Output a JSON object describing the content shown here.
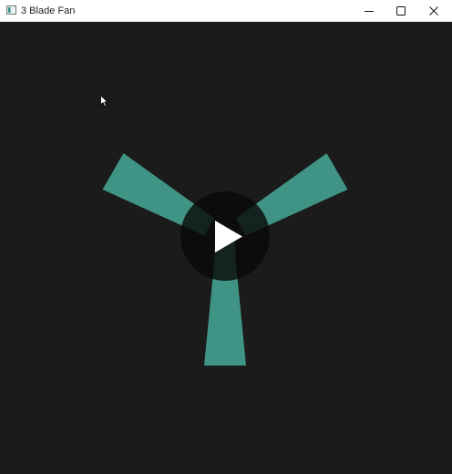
{
  "window": {
    "title": "3 Blade Fan",
    "controls": {
      "minimize_icon": "minimize-icon",
      "maximize_icon": "maximize-icon",
      "close_icon": "close-icon"
    }
  },
  "fan": {
    "blade_count": 3,
    "blade_color": "#409485",
    "background_color": "#1b1b1b",
    "overlay": {
      "icon": "play-icon",
      "color": "#ffffff",
      "backdrop_color": "#0a0a0a"
    }
  },
  "cursor": {
    "icon": "mouse-pointer-icon"
  }
}
